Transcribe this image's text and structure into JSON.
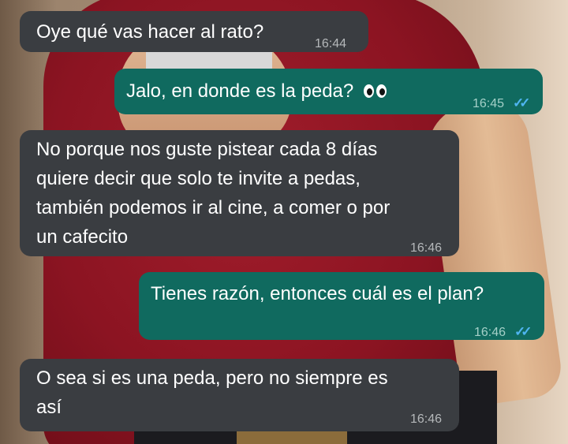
{
  "messages": [
    {
      "direction": "incoming",
      "text": "Oye qué vas hacer al rato?",
      "time": "16:44"
    },
    {
      "direction": "outgoing",
      "text": "Jalo, en donde es la peda?",
      "emoji": "eyes",
      "time": "16:45",
      "status": "read"
    },
    {
      "direction": "incoming",
      "text": "No porque nos guste pistear cada 8 días\nquiere decir que solo te invite a pedas,\ntambién podemos ir al cine, a comer o por\nun cafecito",
      "time": "16:46"
    },
    {
      "direction": "outgoing",
      "text": "Tienes razón, entonces cuál es el plan?",
      "time": "16:46",
      "status": "read"
    },
    {
      "direction": "incoming",
      "text": "O sea si es una peda, pero no siempre es\nasí",
      "time": "16:46"
    }
  ],
  "colors": {
    "incoming_bubble": "#3a3d41",
    "outgoing_bubble": "#106a5f",
    "read_check": "#4fb5f1"
  },
  "icons": {
    "read_receipt": "double-check-icon",
    "emoji": "eyes-emoji-icon"
  }
}
